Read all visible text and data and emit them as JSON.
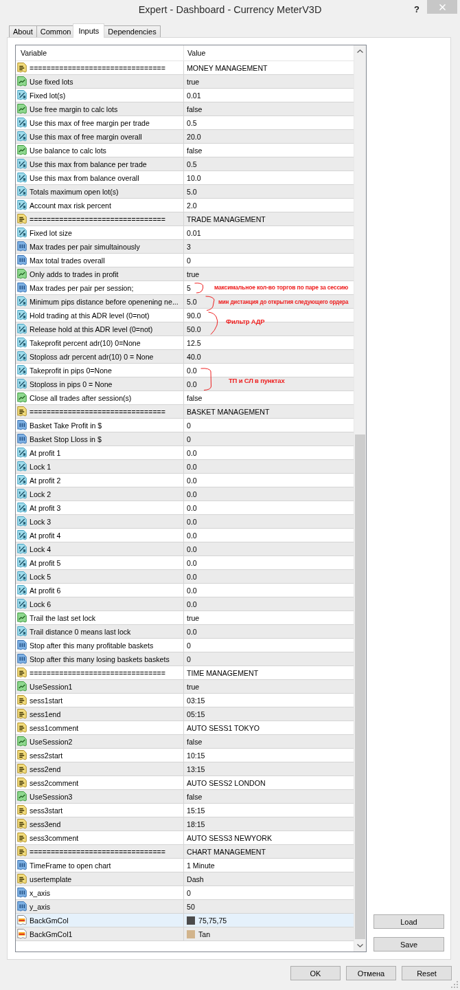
{
  "window": {
    "title": "Expert - Dashboard - Currency MeterV3D",
    "help": "?"
  },
  "tabs": [
    {
      "label": "About",
      "selected": false
    },
    {
      "label": "Common",
      "selected": false
    },
    {
      "label": "Inputs",
      "selected": true
    },
    {
      "label": "Dependencies",
      "selected": false
    }
  ],
  "table": {
    "columns": [
      "Variable",
      "Value"
    ],
    "rows": [
      {
        "kind": "string",
        "name": "================================",
        "value": "MONEY MANAGEMENT",
        "selected": false
      },
      {
        "kind": "bool",
        "name": "Use fixed lots",
        "value": "true",
        "selected": false
      },
      {
        "kind": "double",
        "name": "Fixed lot(s)",
        "value": "0.01",
        "selected": false
      },
      {
        "kind": "bool",
        "name": "Use free margin to calc lots",
        "value": "false",
        "selected": false
      },
      {
        "kind": "double",
        "name": "Use this max of free margin per trade",
        "value": "0.5",
        "selected": false
      },
      {
        "kind": "double",
        "name": "Use this max of free margin overall",
        "value": "20.0",
        "selected": false
      },
      {
        "kind": "bool",
        "name": "Use balance to calc lots",
        "value": "false",
        "selected": false
      },
      {
        "kind": "double",
        "name": "Use this max from balance per trade",
        "value": "0.5",
        "selected": false
      },
      {
        "kind": "double",
        "name": "Use this max from balance overall",
        "value": "10.0",
        "selected": false
      },
      {
        "kind": "double",
        "name": "Totals maximum open lot(s)",
        "value": "5.0",
        "selected": false
      },
      {
        "kind": "double",
        "name": "Account max risk percent",
        "value": "2.0",
        "selected": false
      },
      {
        "kind": "string",
        "name": "================================",
        "value": "TRADE MANAGEMENT",
        "selected": false
      },
      {
        "kind": "double",
        "name": "Fixed lot size",
        "value": "0.01",
        "selected": false
      },
      {
        "kind": "int",
        "name": "Max trades per pair simultainously",
        "value": "3",
        "selected": false
      },
      {
        "kind": "int",
        "name": "Max total trades overall",
        "value": "0",
        "selected": false
      },
      {
        "kind": "bool",
        "name": "Only adds to trades in profit",
        "value": "true",
        "selected": false
      },
      {
        "kind": "int",
        "name": "Max trades per pair per session;",
        "value": "5",
        "selected": false,
        "annotation": "максимальное кол-во торгов по паре за сессию"
      },
      {
        "kind": "double",
        "name": "Minimum pips distance before openening ne...",
        "value": "5.0",
        "selected": false,
        "annotation": "мин дистанция до открытия следующего ордера"
      },
      {
        "kind": "double",
        "name": "Hold trading at this ADR level (0=not)",
        "value": "90.0",
        "selected": false,
        "annotation": "Фильтр АДР"
      },
      {
        "kind": "double",
        "name": "Release hold at this ADR level (0=not)",
        "value": "50.0",
        "selected": false
      },
      {
        "kind": "double",
        "name": "Takeprofit percent adr(10) 0=None",
        "value": "12.5",
        "selected": false
      },
      {
        "kind": "double",
        "name": "Stoploss adr percent adr(10) 0 = None",
        "value": "40.0",
        "selected": false
      },
      {
        "kind": "double",
        "name": "Takeprofit in pips 0=None",
        "value": "0.0",
        "selected": false
      },
      {
        "kind": "double",
        "name": "Stoploss in pips 0 = None",
        "value": "0.0",
        "selected": false,
        "annotation": "ТП и СЛ в пунктах"
      },
      {
        "kind": "bool",
        "name": "Close all trades after session(s)",
        "value": "false",
        "selected": false
      },
      {
        "kind": "string",
        "name": "================================",
        "value": "BASKET MANAGEMENT",
        "selected": false
      },
      {
        "kind": "int",
        "name": "Basket Take Profit in $",
        "value": "0",
        "selected": false
      },
      {
        "kind": "int",
        "name": "Basket Stop Lloss in $",
        "value": "0",
        "selected": false
      },
      {
        "kind": "double",
        "name": "At profit 1",
        "value": "0.0",
        "selected": false
      },
      {
        "kind": "double",
        "name": "Lock 1",
        "value": "0.0",
        "selected": false
      },
      {
        "kind": "double",
        "name": "At profit 2",
        "value": "0.0",
        "selected": false
      },
      {
        "kind": "double",
        "name": "Lock 2",
        "value": "0.0",
        "selected": false
      },
      {
        "kind": "double",
        "name": "At profit 3",
        "value": "0.0",
        "selected": false
      },
      {
        "kind": "double",
        "name": "Lock 3",
        "value": "0.0",
        "selected": false
      },
      {
        "kind": "double",
        "name": "At profit 4",
        "value": "0.0",
        "selected": false
      },
      {
        "kind": "double",
        "name": "Lock 4",
        "value": "0.0",
        "selected": false
      },
      {
        "kind": "double",
        "name": "At profit 5",
        "value": "0.0",
        "selected": false
      },
      {
        "kind": "double",
        "name": "Lock 5",
        "value": "0.0",
        "selected": false
      },
      {
        "kind": "double",
        "name": "At profit 6",
        "value": "0.0",
        "selected": false
      },
      {
        "kind": "double",
        "name": "Lock 6",
        "value": "0.0",
        "selected": false
      },
      {
        "kind": "bool",
        "name": "Trail the last set lock",
        "value": "true",
        "selected": false
      },
      {
        "kind": "double",
        "name": "Trail distance 0 means last lock",
        "value": "0.0",
        "selected": false
      },
      {
        "kind": "int",
        "name": "Stop after this many profitable baskets",
        "value": "0",
        "selected": false
      },
      {
        "kind": "int",
        "name": "Stop after this many losing baskets baskets",
        "value": "0",
        "selected": false
      },
      {
        "kind": "string",
        "name": "================================",
        "value": "TIME MANAGEMENT",
        "selected": false
      },
      {
        "kind": "bool",
        "name": "UseSession1",
        "value": "true",
        "selected": false
      },
      {
        "kind": "string",
        "name": "sess1start",
        "value": "03:15",
        "selected": false
      },
      {
        "kind": "string",
        "name": "sess1end",
        "value": "05:15",
        "selected": false
      },
      {
        "kind": "string",
        "name": "sess1comment",
        "value": "AUTO SESS1 TOKYO",
        "selected": false
      },
      {
        "kind": "bool",
        "name": "UseSession2",
        "value": "false",
        "selected": false
      },
      {
        "kind": "string",
        "name": "sess2start",
        "value": "10:15",
        "selected": false
      },
      {
        "kind": "string",
        "name": "sess2end",
        "value": "13:15",
        "selected": false
      },
      {
        "kind": "string",
        "name": "sess2comment",
        "value": "AUTO SESS2 LONDON",
        "selected": false
      },
      {
        "kind": "bool",
        "name": "UseSession3",
        "value": "false",
        "selected": false
      },
      {
        "kind": "string",
        "name": "sess3start",
        "value": "15:15",
        "selected": false
      },
      {
        "kind": "string",
        "name": "sess3end",
        "value": "18:15",
        "selected": false
      },
      {
        "kind": "string",
        "name": "sess3comment",
        "value": "AUTO SESS3 NEWYORK",
        "selected": false
      },
      {
        "kind": "string",
        "name": "================================",
        "value": "CHART MANAGEMENT",
        "selected": false
      },
      {
        "kind": "int",
        "name": "TimeFrame to open chart",
        "value": "1 Minute",
        "selected": false
      },
      {
        "kind": "string",
        "name": "usertemplate",
        "value": "Dash",
        "selected": false
      },
      {
        "kind": "int",
        "name": "x_axis",
        "value": "0",
        "selected": false
      },
      {
        "kind": "int",
        "name": "y_axis",
        "value": "50",
        "selected": false
      },
      {
        "kind": "color",
        "name": "BackGmCol",
        "value": "75,75,75",
        "color": "#4b4b4b",
        "selected": true
      },
      {
        "kind": "color",
        "name": "BackGmCol1",
        "value": "Tan",
        "color": "#d2b48c",
        "selected": false
      }
    ]
  },
  "side_buttons": [
    "Load",
    "Save"
  ],
  "buttons": [
    "OK",
    "Отмена",
    "Reset"
  ]
}
